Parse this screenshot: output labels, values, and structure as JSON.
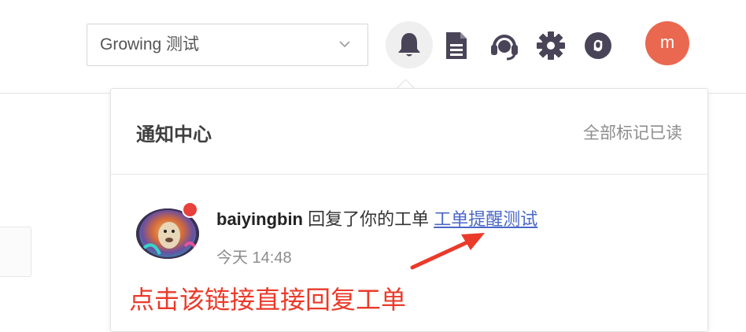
{
  "header": {
    "project_select": {
      "label": "Growing 测试"
    },
    "avatar_initial": "m",
    "icons": [
      "bell-icon",
      "document-icon",
      "headset-icon",
      "gear-icon",
      "link-icon"
    ]
  },
  "notifications": {
    "title": "通知中心",
    "mark_all_read": "全部标记已读",
    "items": [
      {
        "user": "baiyingbin",
        "action": " 回复了你的工单 ",
        "link_text": "工单提醒测试",
        "time": "今天 14:48",
        "unread": true
      }
    ]
  },
  "annotation": {
    "text": "点击该链接直接回复工单"
  },
  "colors": {
    "avatar_bg": "#e9684f",
    "link": "#4a67c8",
    "unread_dot": "#e8403b",
    "annotation": "#ea3a2a",
    "icon": "#4a4458"
  }
}
